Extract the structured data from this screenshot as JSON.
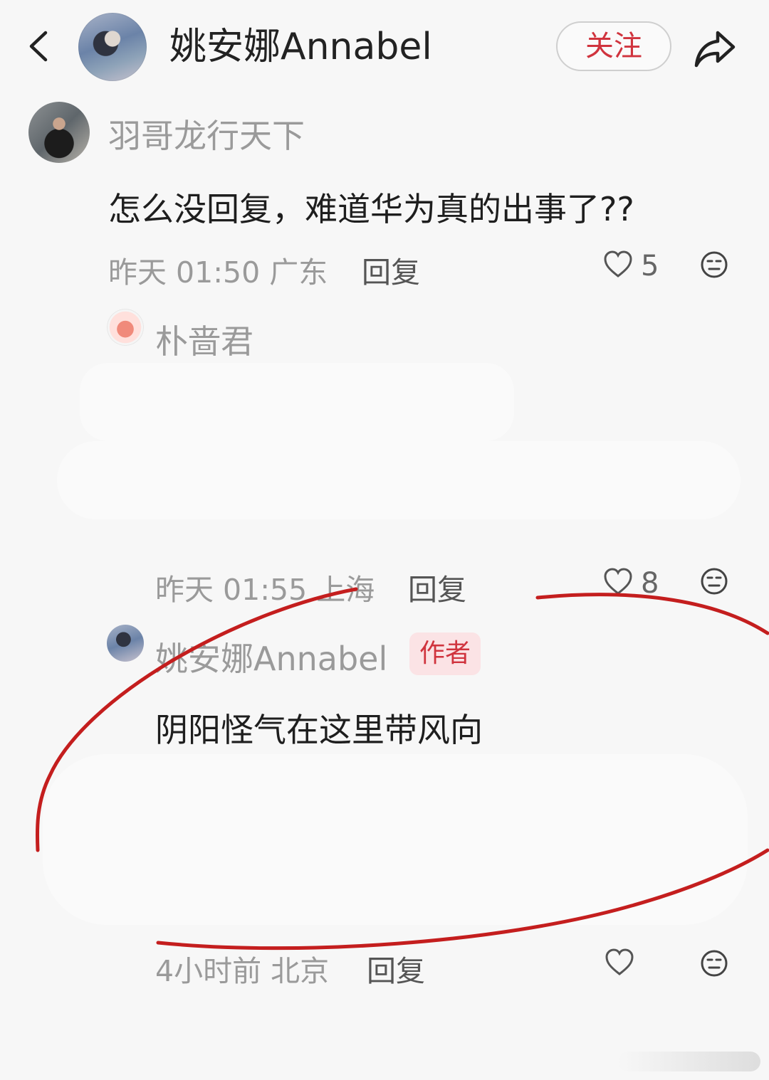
{
  "header": {
    "title": "姚安娜Annabel",
    "follow_label": "关注"
  },
  "comments": [
    {
      "username": "羽哥龙行天下",
      "text": "怎么没回复，难道华为真的出事了??",
      "time_location": "昨天 01:50 广东",
      "reply_label": "回复",
      "likes": "5"
    },
    {
      "username": "朴啬君",
      "text": "",
      "time_location": "昨天 01:55 上海",
      "reply_label": "回复",
      "likes": "8"
    },
    {
      "username": "姚安娜Annabel",
      "badge": "作者",
      "text": "阴阳怪气在这里带风向",
      "time_location": "4小时前 北京",
      "reply_label": "回复",
      "likes": ""
    }
  ],
  "colors": {
    "accent_red": "#d0343e",
    "annotation_red": "#c41e1e",
    "muted_gray": "#9a9a9a"
  },
  "icons": [
    "back-arrow-icon",
    "share-icon",
    "heart-icon",
    "emoji-icon"
  ]
}
